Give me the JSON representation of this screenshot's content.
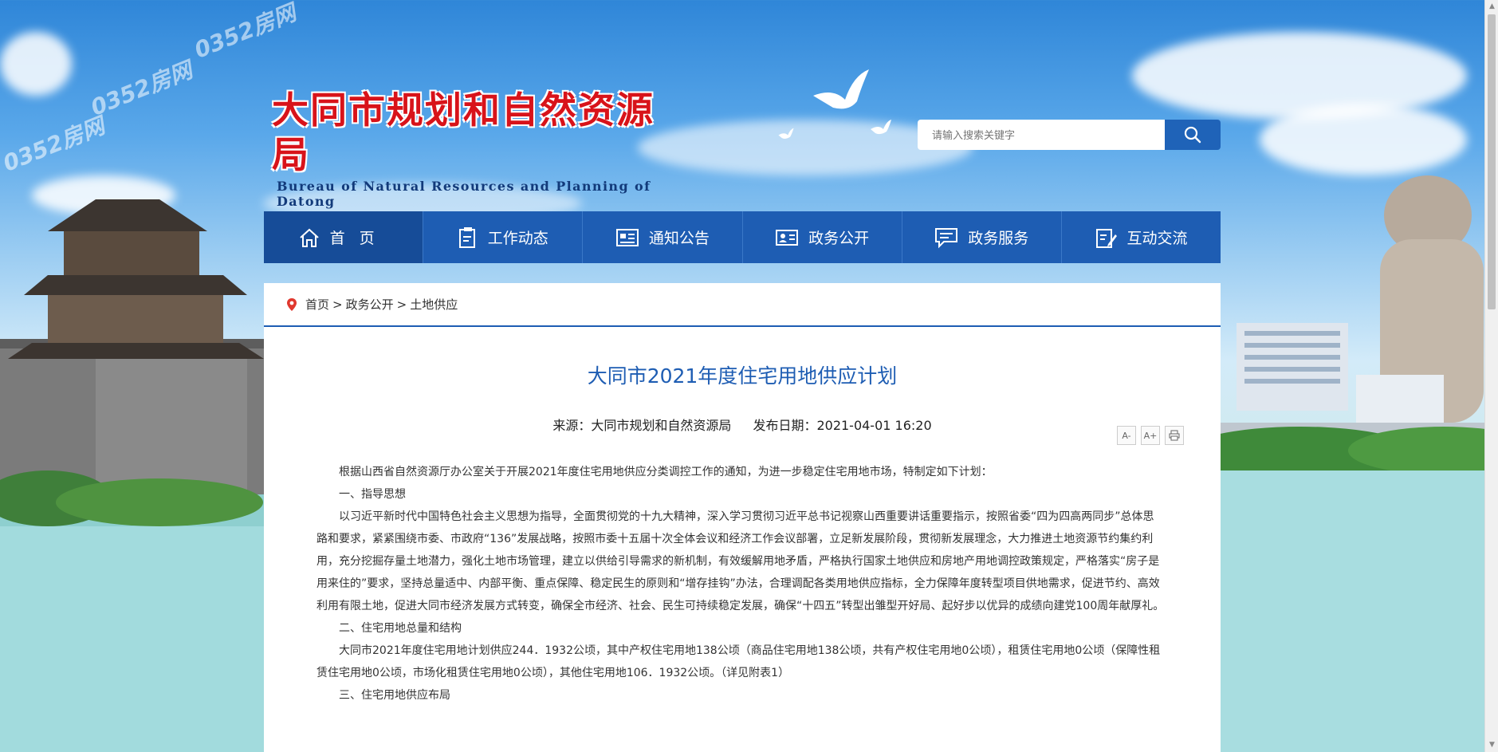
{
  "header": {
    "logo_cn": "大同市规划和自然资源局",
    "logo_en": "Bureau of Natural Resources and Planning of Datong",
    "watermark": "0352房网"
  },
  "search": {
    "placeholder": "请输入搜索关键字",
    "icon": "search-icon"
  },
  "nav": {
    "items": [
      {
        "label": "首页",
        "icon": "home-icon"
      },
      {
        "label": "工作动态",
        "icon": "document-icon"
      },
      {
        "label": "通知公告",
        "icon": "notice-icon"
      },
      {
        "label": "政务公开",
        "icon": "id-card-icon"
      },
      {
        "label": "政务服务",
        "icon": "chat-icon"
      },
      {
        "label": "互动交流",
        "icon": "edit-icon"
      }
    ]
  },
  "breadcrumb": {
    "icon": "location-pin-icon",
    "items": [
      "首页",
      "政务公开",
      "土地供应"
    ],
    "separator": ">"
  },
  "article": {
    "title": "大同市2021年度住宅用地供应计划",
    "source": "来源：大同市规划和自然资源局",
    "date": "发布日期：2021-04-01 16:20",
    "tools": {
      "font_smaller": "A-",
      "font_larger": "A+",
      "print_icon": "print-icon"
    },
    "paragraphs": [
      "根据山西省自然资源厅办公室关于开展2021年度住宅用地供应分类调控工作的通知，为进一步稳定住宅用地市场，特制定如下计划：",
      "一、指导思想",
      "以习近平新时代中国特色社会主义思想为指导，全面贯彻党的十九大精神，深入学习贯彻习近平总书记视察山西重要讲话重要指示，按照省委“四为四高两同步”总体思路和要求，紧紧围绕市委、市政府“136”发展战略，按照市委十五届十次全体会议和经济工作会议部署，立足新发展阶段，贯彻新发展理念，大力推进土地资源节约集约利用，充分挖掘存量土地潜力，强化土地市场管理，建立以供给引导需求的新机制，有效缓解用地矛盾，严格执行国家土地供应和房地产用地调控政策规定，严格落实“房子是用来住的”要求，坚持总量适中、内部平衡、重点保障、稳定民生的原则和“增存挂钩”办法，合理调配各类用地供应指标，全力保障年度转型项目供地需求，促进节约、高效利用有限土地，促进大同市经济发展方式转变，确保全市经济、社会、民生可持续稳定发展，确保“十四五”转型出雏型开好局、起好步以优异的成绩向建党100周年献厚礼。",
      "二、住宅用地总量和结构",
      "大同市2021年度住宅用地计划供应244．1932公顷，其中产权住宅用地138公顷（商品住宅用地138公顷，共有产权住宅用地0公顷），租赁住宅用地0公顷（保障性租赁住宅用地0公顷，市场化租赁住宅用地0公顷），其他住宅用地106．1932公顷。（详见附表1）",
      "三、住宅用地供应布局"
    ]
  },
  "colors": {
    "nav_bg": "#1e5db3",
    "title": "#1e5db3",
    "logo_red": "#d8131a"
  }
}
